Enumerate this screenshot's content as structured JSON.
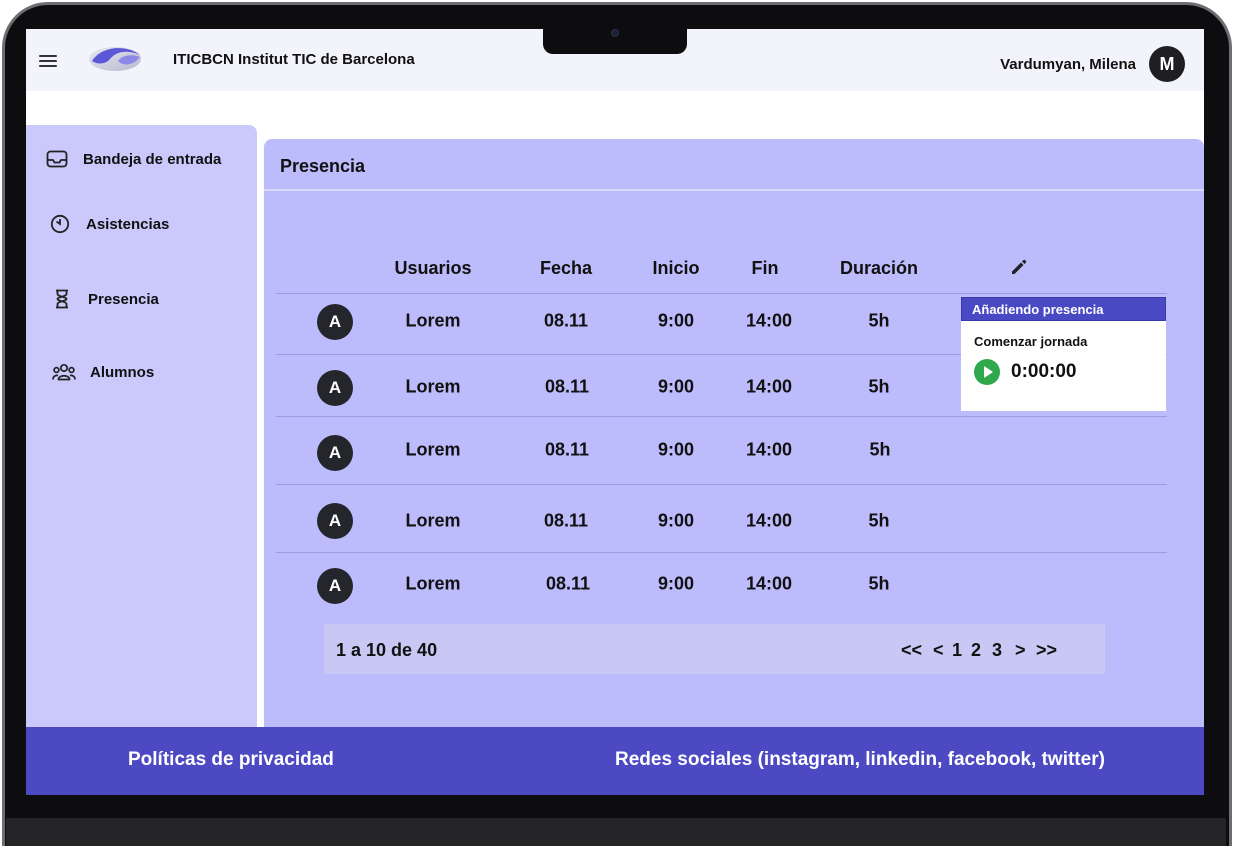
{
  "header": {
    "org_name": "ITICBCN Institut TIC de Barcelona",
    "user_name": "Vardumyan, Milena",
    "user_initial": "M"
  },
  "sidebar": {
    "items": [
      {
        "label": "Bandeja de entrada",
        "icon": "inbox-icon"
      },
      {
        "label": "Asistencias",
        "icon": "timer-icon"
      },
      {
        "label": "Presencia",
        "icon": "hourglass-icon"
      },
      {
        "label": "Alumnos",
        "icon": "group-icon"
      }
    ]
  },
  "main": {
    "title": "Presencia",
    "columns": [
      "Usuarios",
      "Fecha",
      "Inicio",
      "Fin",
      "Duración"
    ],
    "rows": [
      {
        "avatar": "A",
        "usuario": "Lorem",
        "fecha": "08.11",
        "inicio": "9:00",
        "fin": "14:00",
        "duracion": "5h"
      },
      {
        "avatar": "A",
        "usuario": "Lorem",
        "fecha": "08.11",
        "inicio": "9:00",
        "fin": "14:00",
        "duracion": "5h"
      },
      {
        "avatar": "A",
        "usuario": "Lorem",
        "fecha": "08.11",
        "inicio": "9:00",
        "fin": "14:00",
        "duracion": "5h"
      },
      {
        "avatar": "A",
        "usuario": "Lorem",
        "fecha": "08.11",
        "inicio": "9:00",
        "fin": "14:00",
        "duracion": "5h"
      },
      {
        "avatar": "A",
        "usuario": "Lorem",
        "fecha": "08.11",
        "inicio": "9:00",
        "fin": "14:00",
        "duracion": "5h"
      }
    ],
    "pagination": {
      "info": "1 a 10 de 40",
      "first": "<<",
      "prev": "<",
      "pages": [
        "1",
        "2",
        "3"
      ],
      "next": ">",
      "last": ">>"
    }
  },
  "popup": {
    "title": "Añadiendo presencia",
    "subtitle": "Comenzar jornada",
    "timer": "0:00:00"
  },
  "footer": {
    "privacy": "Políticas de privacidad",
    "social": "Redes sociales (instagram, linkedin, facebook, twitter)"
  },
  "colors": {
    "sidebar_bg": "#cbc9fb",
    "panel_bg": "#bcbbfc",
    "footer_bg": "#4c49c3",
    "accent": "#4a49c4",
    "play_green": "#2fa84d"
  }
}
